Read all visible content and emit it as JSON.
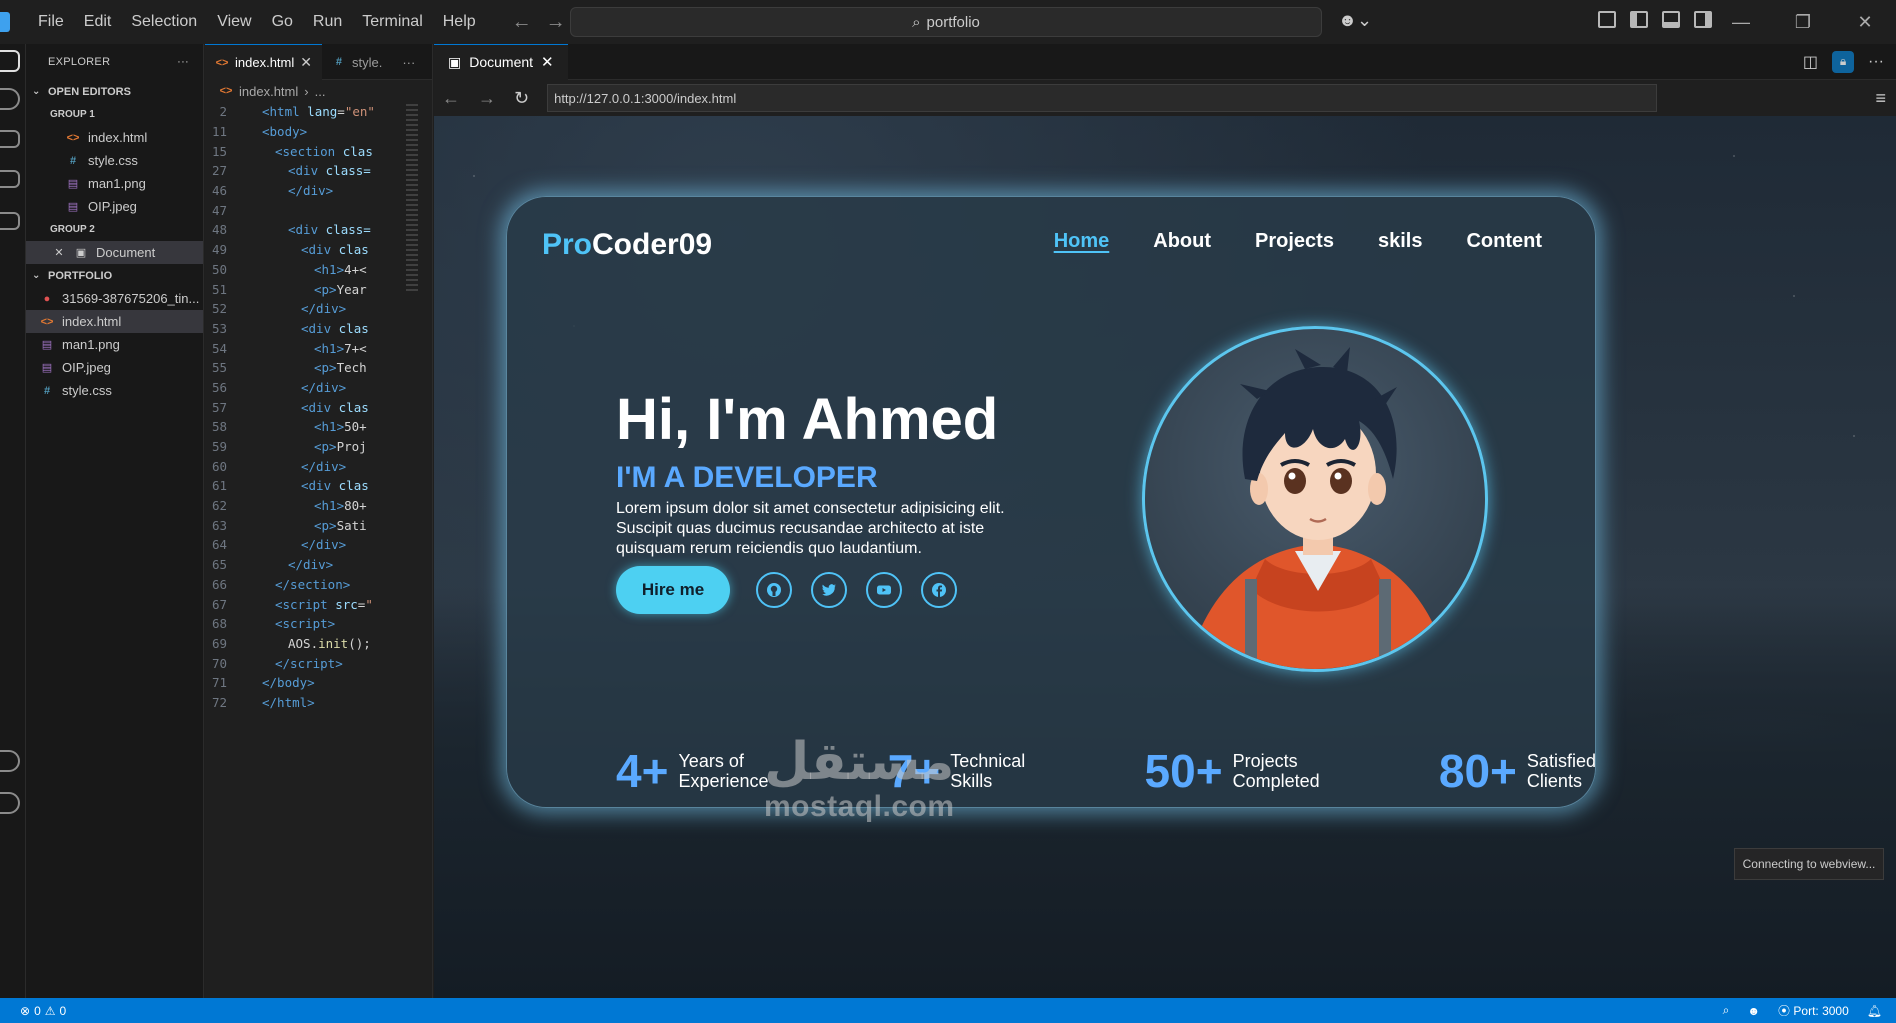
{
  "titlebar": {
    "menu": [
      "File",
      "Edit",
      "Selection",
      "View",
      "Go",
      "Run",
      "Terminal",
      "Help"
    ],
    "search": "portfolio"
  },
  "explorer": {
    "title": "EXPLORER",
    "open_editors": "OPEN EDITORS",
    "group1": "GROUP 1",
    "group1_files": [
      "index.html",
      "style.css",
      "man1.png",
      "OIP.jpeg"
    ],
    "group2": "GROUP 2",
    "group2_files": [
      "Document"
    ],
    "portfolio": "PORTFOLIO",
    "portfolio_files": [
      "31569-387675206_tin...",
      "index.html",
      "man1.png",
      "OIP.jpeg",
      "style.css"
    ]
  },
  "editor": {
    "tabs": [
      "index.html",
      "style."
    ],
    "breadcrumb": "index.html",
    "breadcrumb_more": "...",
    "lines": [
      {
        "n": "2",
        "indent": 1,
        "html": "<span class='tag'>&lt;html</span> <span class='attr'>lang</span><span class='plain'>=</span><span class='str'>\"en\"</span>"
      },
      {
        "n": "11",
        "indent": 1,
        "html": "<span class='tag'>&lt;body&gt;</span>"
      },
      {
        "n": "15",
        "indent": 2,
        "html": "<span class='tag'>&lt;section</span> <span class='attr'>clas</span>"
      },
      {
        "n": "27",
        "indent": 3,
        "html": "<span class='tag'>&lt;div</span> <span class='attr'>class=</span>"
      },
      {
        "n": "46",
        "indent": 3,
        "html": "<span class='tag'>&lt;/div&gt;</span>"
      },
      {
        "n": "47",
        "indent": 0,
        "html": ""
      },
      {
        "n": "48",
        "indent": 3,
        "html": "<span class='tag'>&lt;div</span> <span class='attr'>class=</span>"
      },
      {
        "n": "49",
        "indent": 4,
        "html": "<span class='tag'>&lt;div</span> <span class='attr'>clas</span>"
      },
      {
        "n": "50",
        "indent": 5,
        "html": "<span class='tag'>&lt;h1&gt;</span><span class='plain'>4+&lt;</span>"
      },
      {
        "n": "51",
        "indent": 5,
        "html": "<span class='tag'>&lt;p&gt;</span><span class='plain'>Year</span>"
      },
      {
        "n": "52",
        "indent": 4,
        "html": "<span class='tag'>&lt;/div&gt;</span>"
      },
      {
        "n": "53",
        "indent": 4,
        "html": "<span class='tag'>&lt;div</span> <span class='attr'>clas</span>"
      },
      {
        "n": "54",
        "indent": 5,
        "html": "<span class='tag'>&lt;h1&gt;</span><span class='plain'>7+&lt;</span>"
      },
      {
        "n": "55",
        "indent": 5,
        "html": "<span class='tag'>&lt;p&gt;</span><span class='plain'>Tech</span>"
      },
      {
        "n": "56",
        "indent": 4,
        "html": "<span class='tag'>&lt;/div&gt;</span>"
      },
      {
        "n": "57",
        "indent": 4,
        "html": "<span class='tag'>&lt;div</span> <span class='attr'>clas</span>"
      },
      {
        "n": "58",
        "indent": 5,
        "html": "<span class='tag'>&lt;h1&gt;</span><span class='plain'>50+</span>"
      },
      {
        "n": "59",
        "indent": 5,
        "html": "<span class='tag'>&lt;p&gt;</span><span class='plain'>Proj</span>"
      },
      {
        "n": "60",
        "indent": 4,
        "html": "<span class='tag'>&lt;/div&gt;</span>"
      },
      {
        "n": "61",
        "indent": 4,
        "html": "<span class='tag'>&lt;div</span> <span class='attr'>clas</span>"
      },
      {
        "n": "62",
        "indent": 5,
        "html": "<span class='tag'>&lt;h1&gt;</span><span class='plain'>80+</span>"
      },
      {
        "n": "63",
        "indent": 5,
        "html": "<span class='tag'>&lt;p&gt;</span><span class='plain'>Sati</span>"
      },
      {
        "n": "64",
        "indent": 4,
        "html": "<span class='tag'>&lt;/div&gt;</span>"
      },
      {
        "n": "65",
        "indent": 3,
        "html": "<span class='tag'>&lt;/div&gt;</span>"
      },
      {
        "n": "66",
        "indent": 2,
        "html": "<span class='tag'>&lt;/section&gt;</span>"
      },
      {
        "n": "67",
        "indent": 2,
        "html": "<span class='tag'>&lt;script</span> <span class='attr'>src</span><span class='plain'>=</span><span class='str'>\"</span>"
      },
      {
        "n": "68",
        "indent": 2,
        "html": "<span class='tag'>&lt;script&gt;</span>"
      },
      {
        "n": "69",
        "indent": 3,
        "html": "<span class='plain'>AOS.</span><span class='fn'>init</span><span class='plain'>();</span>"
      },
      {
        "n": "70",
        "indent": 2,
        "html": "<span class='tag'>&lt;/script&gt;</span>"
      },
      {
        "n": "71",
        "indent": 1,
        "html": "<span class='tag'>&lt;/body&gt;</span>"
      },
      {
        "n": "72",
        "indent": 1,
        "html": "<span class='tag'>&lt;/html&gt;</span>"
      }
    ]
  },
  "browser": {
    "tab": "Document",
    "url": "http://127.0.0.1:3000/index.html"
  },
  "site": {
    "brand_pro": "Pro",
    "brand_rest": "Coder09",
    "nav": [
      "Home",
      "About",
      "Projects",
      "skils",
      "Content"
    ],
    "greeting": "Hi, I'm Ahmed",
    "role": "I'M A DEVELOPER",
    "description": "Lorem ipsum dolor sit amet consectetur adipisicing elit. Suscipit quas ducimus recusandae architecto at iste quisquam rerum reiciendis quo laudantium.",
    "hire": "Hire me",
    "socials": [
      "github-icon",
      "twitter-icon",
      "youtube-icon",
      "facebook-icon"
    ],
    "stats": [
      {
        "value": "4+",
        "label1": "Years of",
        "label2": "Experience"
      },
      {
        "value": "7+",
        "label1": "Technical",
        "label2": "Skills"
      },
      {
        "value": "50+",
        "label1": "Projects",
        "label2": "Completed"
      },
      {
        "value": "80+",
        "label1": "Satisfied",
        "label2": "Clients"
      }
    ]
  },
  "watermark": {
    "arabic": "مستقل",
    "latin": "mostaql.com"
  },
  "toast": "Connecting to webview...",
  "status": {
    "errors": "0",
    "warnings": "0",
    "port": "Port: 3000"
  },
  "colors": {
    "accent": "#4fc3f7",
    "stat": "#5aa9ff",
    "statusbar": "#0078d4"
  }
}
